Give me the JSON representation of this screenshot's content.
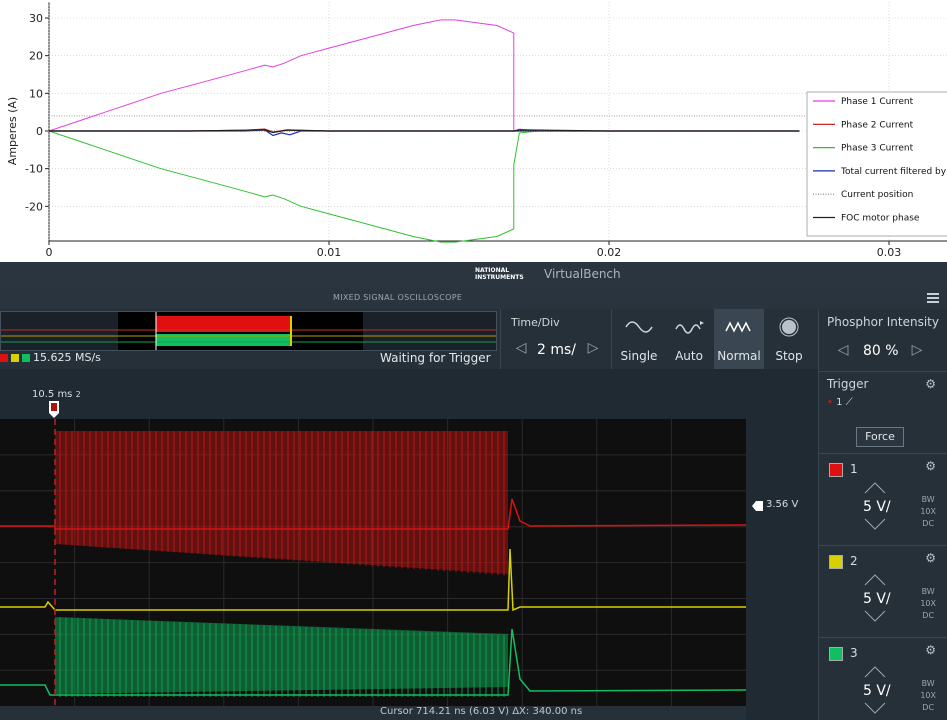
{
  "chart_data": {
    "type": "line",
    "title": "",
    "xlabel": "",
    "ylabel": "Amperes (A)",
    "xlim": [
      0,
      0.032
    ],
    "ylim": [
      -30,
      30
    ],
    "xticks": [
      "0",
      "0.01",
      "0.02",
      "0.03"
    ],
    "xtick_values": [
      0,
      0.01,
      0.02,
      0.03
    ],
    "yticks": [
      "30",
      "20",
      "10",
      "0",
      "-10",
      "-20"
    ],
    "ytick_values": [
      30,
      20,
      10,
      0,
      -10,
      -20
    ],
    "grid": true,
    "legend_position": "right",
    "series": [
      {
        "name": "Phase 1 Current",
        "color": "#e040e0",
        "x": [
          0,
          0.001,
          0.002,
          0.003,
          0.004,
          0.005,
          0.006,
          0.007,
          0.0077,
          0.008,
          0.0084,
          0.009,
          0.01,
          0.011,
          0.012,
          0.013,
          0.014,
          0.0145,
          0.015,
          0.016,
          0.0166,
          0.0166,
          0.0168,
          0.0175,
          0.02,
          0.025,
          0.0268
        ],
        "y": [
          0,
          2.5,
          5,
          7.5,
          10,
          12,
          14,
          16,
          17.5,
          17,
          18,
          20,
          22,
          24,
          26,
          28,
          29.5,
          29.5,
          29,
          28,
          26,
          0,
          0.5,
          0,
          0,
          0,
          0
        ]
      },
      {
        "name": "Phase 2 Current",
        "color": "#c01010",
        "x": [
          0,
          0.005,
          0.007,
          0.0077,
          0.008,
          0.0085,
          0.01,
          0.015,
          0.0166,
          0.0168,
          0.02,
          0.025,
          0.0268
        ],
        "y": [
          0,
          0,
          0.2,
          0.5,
          -0.3,
          0.3,
          0,
          0,
          0,
          0,
          0,
          0,
          0
        ]
      },
      {
        "name": "Phase 3 Current",
        "color": "#30c030",
        "x": [
          0,
          0.001,
          0.002,
          0.003,
          0.004,
          0.005,
          0.006,
          0.007,
          0.0077,
          0.008,
          0.0084,
          0.009,
          0.01,
          0.011,
          0.012,
          0.013,
          0.014,
          0.0145,
          0.015,
          0.016,
          0.0166,
          0.0166,
          0.0168,
          0.0175,
          0.02,
          0.025,
          0.0268
        ],
        "y": [
          0,
          -2.5,
          -5,
          -7.5,
          -10,
          -12,
          -14,
          -16,
          -17.5,
          -17,
          -18,
          -20,
          -22,
          -24,
          -26,
          -28,
          -29.5,
          -29.5,
          -29,
          -28,
          -26,
          -9,
          -0.5,
          0,
          0,
          0,
          0
        ]
      },
      {
        "name": "Total current filtered by",
        "color": "#1a2ab0",
        "x": [
          0,
          0.005,
          0.007,
          0.0077,
          0.008,
          0.0083,
          0.0086,
          0.009,
          0.01,
          0.015,
          0.0166,
          0.0168,
          0.02,
          0.025,
          0.0268
        ],
        "y": [
          0,
          0,
          0,
          0.3,
          -1.2,
          -0.5,
          -1,
          0,
          0,
          0,
          0,
          0,
          0,
          0,
          0
        ]
      },
      {
        "name": "Current position",
        "color": "#808080",
        "x": [
          0,
          0.0268
        ],
        "y": [
          0,
          0
        ]
      },
      {
        "name": "FOC motor phase",
        "color": "#202020",
        "x": [
          0,
          0.005,
          0.0077,
          0.008,
          0.0085,
          0.01,
          0.015,
          0.0166,
          0.0168,
          0.02,
          0.025,
          0.0268
        ],
        "y": [
          0,
          0,
          0.3,
          -0.4,
          0.2,
          0,
          0,
          0,
          0.3,
          0,
          0,
          0
        ]
      }
    ],
    "reference_lines": [
      {
        "y": 4,
        "color": "#909090",
        "style": "dotted"
      }
    ]
  },
  "virtualbench": {
    "brand_line1": "NATIONAL",
    "brand_line2": "INSTRUMENTS",
    "app_name": "VirtualBench",
    "instrument_title": "MIXED SIGNAL OSCILLOSCOPE",
    "sample_rate": "15.625 MS/s",
    "status": "Waiting for Trigger",
    "time_div_label": "Time/Div",
    "time_div_value": "2 ms/",
    "modes": [
      "Single",
      "Auto",
      "Normal",
      "Stop"
    ],
    "active_mode": "Normal",
    "phosphor_label": "Phosphor Intensity",
    "phosphor_value": "80 %",
    "trigger_label": "Trigger",
    "trigger_source": "1",
    "force_label": "Force",
    "cursor_label": "10.5 ms",
    "cursor_tag": "2",
    "trigger_level": "3.56 V",
    "channels": [
      {
        "num": "1",
        "color": "#e01010",
        "volt": "5 V/",
        "bw": "BW",
        "probe": "10X",
        "coupling": "DC"
      },
      {
        "num": "2",
        "color": "#d8d000",
        "volt": "5 V/",
        "bw": "BW",
        "probe": "10X",
        "coupling": "DC"
      },
      {
        "num": "3",
        "color": "#10c060",
        "volt": "5 V/",
        "bw": "BW",
        "probe": "10X",
        "coupling": "DC"
      }
    ],
    "status_bar_text": "Cursor 714.21 ns (6.03 V)      ΔX: 340.00 ns"
  }
}
